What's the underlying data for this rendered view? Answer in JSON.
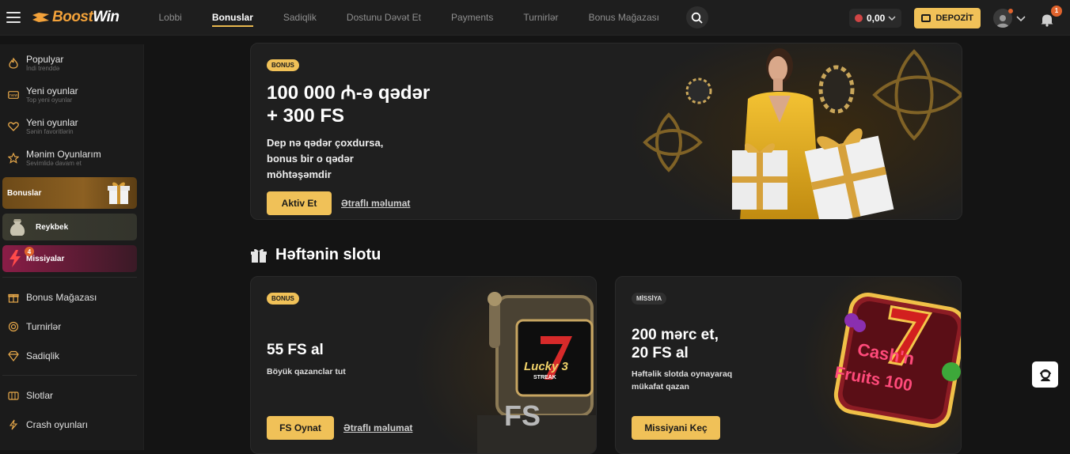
{
  "header": {
    "logo_boost": "Boost",
    "logo_win": "Win",
    "nav": [
      {
        "label": "Lobbi"
      },
      {
        "label": "Bonuslar",
        "active": true
      },
      {
        "label": "Sadiqlik"
      },
      {
        "label": "Dostunu Dəvət Et"
      },
      {
        "label": "Payments"
      },
      {
        "label": "Turnirlər"
      },
      {
        "label": "Bonus Mağazası"
      }
    ],
    "balance": "0,00",
    "deposit_label": "DEPOZİT",
    "notifications_count": "1"
  },
  "sidebar": {
    "items": [
      {
        "title": "Populyar",
        "subtitle": "İndi trenddə",
        "icon": "fire-icon"
      },
      {
        "title": "Yeni oyunlar",
        "subtitle": "Top yeni oyunlar",
        "icon": "new-icon"
      },
      {
        "title": "Yeni oyunlar",
        "subtitle": "Sənin favoritlərin",
        "icon": "heart-icon"
      },
      {
        "title": "Mənim Oyunlarım",
        "subtitle": "Sevimlidə davam et",
        "icon": "star-icon"
      }
    ],
    "cards": {
      "bonuslar": "Bonuslar",
      "reykbek": "Reykbek",
      "missiyalar": "Missiyalar",
      "missiyalar_badge": "4"
    },
    "links": [
      {
        "label": "Bonus Mağazası",
        "icon": "gift-icon"
      },
      {
        "label": "Turnirlər",
        "icon": "trophy-icon"
      },
      {
        "label": "Sadiqlik",
        "icon": "diamond-icon"
      }
    ],
    "links2": [
      {
        "label": "Slotlar",
        "icon": "slot-icon"
      },
      {
        "label": "Crash oyunları",
        "icon": "lightning-icon"
      }
    ]
  },
  "hero": {
    "pill": "BONUS",
    "title_line1": "100 000 ₼-ə qədər",
    "title_line2": "+ 300 FS",
    "desc_line1": "Dep nə qədər çoxdursa,",
    "desc_line2": "bonus bir o qədər",
    "desc_line3": "möhtəşəmdir",
    "button": "Aktiv Et",
    "link": "Ətraflı məlumat"
  },
  "section": {
    "title": "Həftənin slotu"
  },
  "card1": {
    "pill": "BONUS",
    "title": "55 FS al",
    "desc": "Böyük qazanclar tut",
    "button": "FS Oynat",
    "link": "Ətraflı məlumat",
    "art_label": "FS",
    "slot_name": "Lucky 3",
    "slot_sub": "STREAK"
  },
  "card2": {
    "pill": "MİSSİYA",
    "title_line1": "200 mərc et,",
    "title_line2": "20 FS al",
    "desc_line1": "Həftəlik slotda oynayaraq",
    "desc_line2": "mükafat qazan",
    "button": "Missiyani Keç",
    "slot_name_1": "Cash'n",
    "slot_name_2": "Fruits 100"
  },
  "colors": {
    "accent": "#f0c158",
    "orange": "#e0632d",
    "background": "#141414"
  }
}
